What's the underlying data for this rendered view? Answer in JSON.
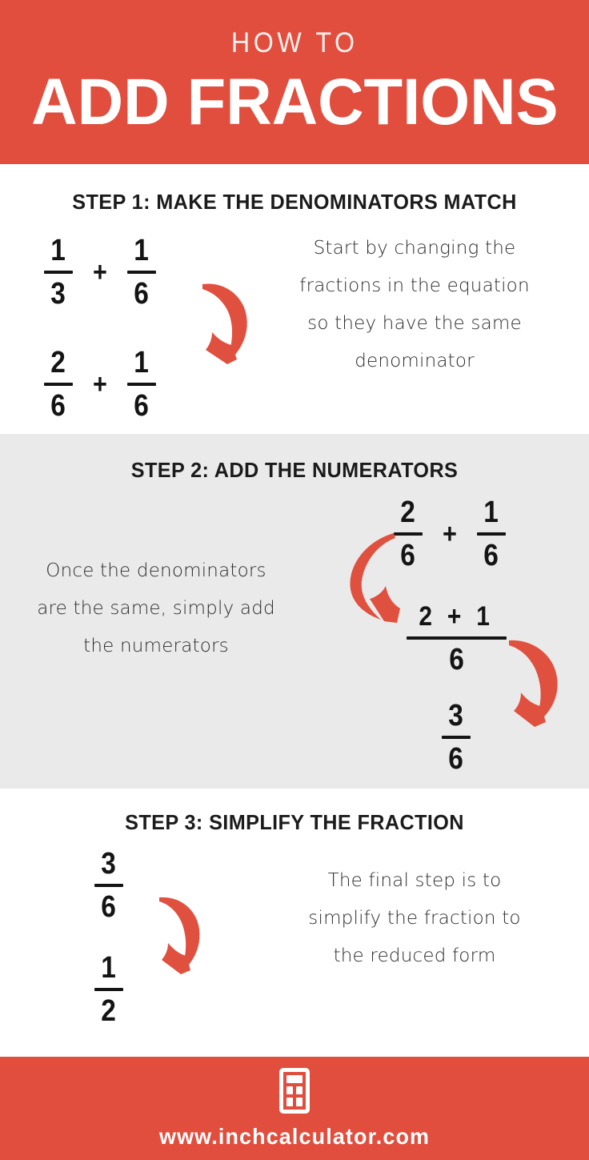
{
  "header": {
    "eyebrow": "HOW TO",
    "title": "ADD FRACTIONS",
    "bg_color": "#e14e3e"
  },
  "steps": [
    {
      "title": "STEP 1: MAKE THE DENOMINATORS MATCH",
      "description": "Start by changing the fractions in the equation so they have the same denominator",
      "bg_color": "#ffffff",
      "math": {
        "row1": {
          "f1_num": "1",
          "f1_den": "3",
          "operator": "+",
          "f2_num": "1",
          "f2_den": "6"
        },
        "row2": {
          "f1_num": "2",
          "f1_den": "6",
          "operator": "+",
          "f2_num": "1",
          "f2_den": "6"
        }
      }
    },
    {
      "title": "STEP 2: ADD THE NUMERATORS",
      "description": "Once the denominators are the same, simply add the numerators",
      "bg_color": "#eaeaea",
      "math": {
        "row1": {
          "f1_num": "2",
          "f1_den": "6",
          "operator": "+",
          "f2_num": "1",
          "f2_den": "6"
        },
        "row2": {
          "num": "2 + 1",
          "den": "6"
        },
        "row3": {
          "num": "3",
          "den": "6"
        }
      }
    },
    {
      "title": "STEP 3: SIMPLIFY THE FRACTION",
      "description": "The final step is to simplify the fraction to the reduced form",
      "bg_color": "#ffffff",
      "math": {
        "row1": {
          "num": "3",
          "den": "6"
        },
        "row2": {
          "num": "1",
          "den": "2"
        }
      }
    }
  ],
  "arrows": {
    "color": "#e0503f",
    "count": 4,
    "labels": [
      "step1-arrow",
      "step2-arrow-top",
      "step2-arrow-bottom",
      "step3-arrow"
    ]
  },
  "footer": {
    "icon": "calculator-icon",
    "url": "www.inchcalculator.com",
    "bg_color": "#e14e3e"
  }
}
